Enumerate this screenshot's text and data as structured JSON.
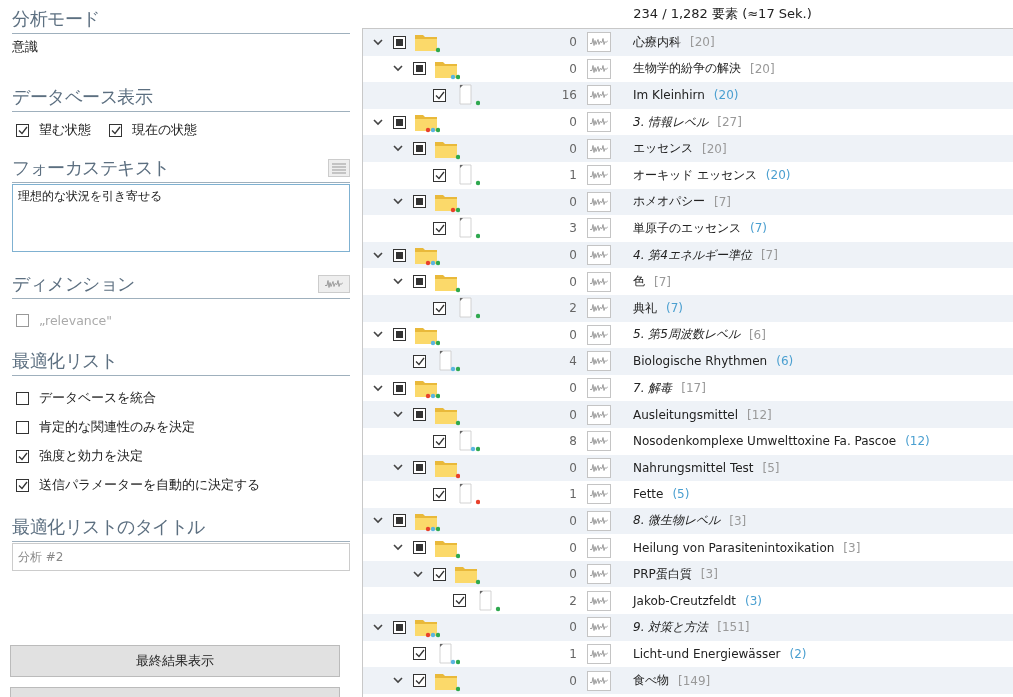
{
  "sidebar": {
    "sections": [
      {
        "kind": "mode",
        "title": "分析モード",
        "value": "意識"
      },
      {
        "kind": "check-row",
        "title": "データベース表示",
        "options": [
          {
            "label": "望む状態",
            "checked": true,
            "disabled": false
          },
          {
            "label": "現在の状態",
            "checked": true,
            "disabled": false
          }
        ]
      },
      {
        "kind": "textarea",
        "title": "フォーカステキスト",
        "value": "理想的な状況を引き寄せる"
      },
      {
        "kind": "check-list",
        "title": "ディメンション",
        "wave_button": true,
        "options": [
          {
            "label": "„relevance\"",
            "checked": false,
            "disabled": true
          }
        ]
      },
      {
        "kind": "check-list",
        "title": "最適化リスト",
        "options": [
          {
            "label": "データベースを統合",
            "checked": false,
            "disabled": false
          },
          {
            "label": "肯定的な関連性のみを決定",
            "checked": false,
            "disabled": false
          },
          {
            "label": "強度と効力を決定",
            "checked": true,
            "disabled": false
          },
          {
            "label": "送信パラメーターを自動的に決定する",
            "checked": true,
            "disabled": false
          }
        ]
      },
      {
        "kind": "input",
        "title": "最適化リストのタイトル",
        "placeholder": "分析 #2"
      }
    ],
    "buttons": [
      "最終結果表示"
    ],
    "more_buttons_below": true
  },
  "tree": {
    "summary": "234 / 1,282 要素 (≈17 Sek.)",
    "items": [
      {
        "children": [
          {
            "kind": "folder",
            "checked": false,
            "partial": true,
            "expanded": true,
            "count": "0",
            "label": "心療内科",
            "tally": "[20]",
            "emphasized": false,
            "markers": [
              {
                "color": "#2fa84f"
              }
            ],
            "children": [
              {
                "kind": "folder",
                "checked": false,
                "partial": true,
                "expanded": true,
                "count": "0",
                "label": "生物学的紛争の解決",
                "tally": "[20]",
                "emphasized": false,
                "markers": [
                  {
                    "color": "#5bb5e0"
                  },
                  {
                    "color": "#2fa84f"
                  }
                ],
                "children": [
                  {
                    "kind": "file",
                    "checked": true,
                    "partial": false,
                    "count": "16",
                    "label": "Im Kleinhirn",
                    "tally": "(20)",
                    "emphasized": false,
                    "markers": [
                      {
                        "color": "#2fa84f"
                      }
                    ]
                  }
                ]
              }
            ]
          }
        ]
      },
      {
        "kind": "folder",
        "checked": false,
        "partial": true,
        "expanded": true,
        "count": "0",
        "label": "3. 情報レベル",
        "tally": "[27]",
        "emphasized": true,
        "markers": [
          {
            "color": "#e8412c"
          },
          {
            "color": "#5bb5e0"
          },
          {
            "color": "#2fa84f"
          }
        ],
        "children": [
          {
            "kind": "folder",
            "checked": false,
            "partial": true,
            "expanded": true,
            "count": "0",
            "label": "エッセンス",
            "tally": "[20]",
            "emphasized": false,
            "markers": [
              {
                "color": "#2fa84f"
              }
            ],
            "children": [
              {
                "kind": "file",
                "checked": true,
                "partial": false,
                "count": "1",
                "label": "オーキッド エッセンス",
                "tally": "(20)",
                "emphasized": false,
                "markers": [
                  {
                    "color": "#2fa84f"
                  }
                ]
              }
            ]
          },
          {
            "kind": "folder",
            "checked": false,
            "partial": true,
            "expanded": true,
            "count": "0",
            "label": "ホメオパシー",
            "tally": "[7]",
            "emphasized": false,
            "markers": [
              {
                "color": "#e8412c"
              },
              {
                "color": "#2fa84f"
              }
            ],
            "children": [
              {
                "kind": "file",
                "checked": true,
                "partial": false,
                "count": "3",
                "label": "単原子のエッセンス",
                "tally": "(7)",
                "emphasized": false,
                "markers": [
                  {
                    "color": "#2fa84f"
                  }
                ]
              }
            ]
          }
        ]
      },
      {
        "kind": "folder",
        "checked": false,
        "partial": true,
        "expanded": true,
        "count": "0",
        "label": "4. 第4エネルギー準位",
        "tally": "[7]",
        "emphasized": true,
        "markers": [
          {
            "color": "#e8412c"
          },
          {
            "color": "#5bb5e0"
          },
          {
            "color": "#2fa84f"
          }
        ],
        "children": [
          {
            "kind": "folder",
            "checked": false,
            "partial": true,
            "expanded": true,
            "count": "0",
            "label": "色",
            "tally": "[7]",
            "emphasized": false,
            "markers": [
              {
                "color": "#2fa84f"
              }
            ],
            "children": [
              {
                "kind": "file",
                "checked": true,
                "partial": false,
                "count": "2",
                "label": "典礼",
                "tally": "(7)",
                "emphasized": false,
                "markers": [
                  {
                    "color": "#2fa84f"
                  }
                ]
              }
            ]
          }
        ]
      },
      {
        "kind": "folder",
        "checked": false,
        "partial": true,
        "expanded": true,
        "count": "0",
        "label": "5. 第5周波数レベル",
        "tally": "[6]",
        "emphasized": true,
        "markers": [
          {
            "color": "#5bb5e0"
          },
          {
            "color": "#2fa84f"
          }
        ],
        "children": [
          {
            "kind": "file",
            "checked": true,
            "partial": false,
            "count": "4",
            "label": "Biologische Rhythmen",
            "tally": "(6)",
            "emphasized": false,
            "markers": [
              {
                "color": "#5bb5e0"
              },
              {
                "color": "#2fa84f"
              }
            ]
          }
        ]
      },
      {
        "kind": "folder",
        "checked": false,
        "partial": true,
        "expanded": true,
        "count": "0",
        "label": "7. 解毒",
        "tally": "[17]",
        "emphasized": true,
        "markers": [
          {
            "color": "#e8412c"
          },
          {
            "color": "#5bb5e0"
          },
          {
            "color": "#2fa84f"
          }
        ],
        "children": [
          {
            "kind": "folder",
            "checked": false,
            "partial": true,
            "expanded": true,
            "count": "0",
            "label": "Ausleitungsmittel",
            "tally": "[12]",
            "emphasized": false,
            "markers": [
              {
                "color": "#2fa84f"
              }
            ],
            "children": [
              {
                "kind": "file",
                "checked": true,
                "partial": false,
                "count": "8",
                "label": "Nosodenkomplexe Umwelttoxine Fa. Pascoe",
                "tally": "(12)",
                "emphasized": false,
                "markers": [
                  {
                    "color": "#5bb5e0"
                  },
                  {
                    "color": "#2fa84f"
                  }
                ]
              }
            ]
          },
          {
            "kind": "folder",
            "checked": false,
            "partial": true,
            "expanded": true,
            "count": "0",
            "label": "Nahrungsmittel Test",
            "tally": "[5]",
            "emphasized": false,
            "markers": [
              {
                "color": "#e8412c"
              }
            ],
            "children": [
              {
                "kind": "file",
                "checked": true,
                "partial": false,
                "count": "1",
                "label": "Fette",
                "tally": "(5)",
                "emphasized": false,
                "markers": [
                  {
                    "color": "#e8412c"
                  }
                ]
              }
            ]
          }
        ]
      },
      {
        "kind": "folder",
        "checked": false,
        "partial": true,
        "expanded": true,
        "count": "0",
        "label": "8. 微生物レベル",
        "tally": "[3]",
        "emphasized": true,
        "markers": [
          {
            "color": "#e8412c"
          },
          {
            "color": "#5bb5e0"
          },
          {
            "color": "#2fa84f"
          }
        ],
        "children": [
          {
            "kind": "folder",
            "checked": false,
            "partial": true,
            "expanded": true,
            "count": "0",
            "label": "Heilung von Parasitenintoxikation",
            "tally": "[3]",
            "emphasized": false,
            "markers": [
              {
                "color": "#2fa84f"
              }
            ],
            "children": [
              {
                "kind": "folder",
                "checked": true,
                "partial": false,
                "expanded": true,
                "count": "0",
                "label": "PRP蛋白質",
                "tally": "[3]",
                "emphasized": false,
                "markers": [
                  {
                    "color": "#2fa84f"
                  }
                ],
                "children": [
                  {
                    "kind": "file",
                    "checked": true,
                    "partial": false,
                    "count": "2",
                    "label": "Jakob-Creutzfeldt",
                    "tally": "(3)",
                    "emphasized": false,
                    "markers": [
                      {
                        "color": "#2fa84f"
                      }
                    ]
                  }
                ]
              }
            ]
          }
        ]
      },
      {
        "kind": "folder",
        "checked": false,
        "partial": true,
        "expanded": true,
        "count": "0",
        "label": "9. 対策と方法",
        "tally": "[151]",
        "emphasized": true,
        "markers": [
          {
            "color": "#e8412c"
          },
          {
            "color": "#5bb5e0"
          },
          {
            "color": "#2fa84f"
          }
        ],
        "children": [
          {
            "kind": "file",
            "checked": true,
            "partial": false,
            "count": "1",
            "label": "Licht-und Energiewässer",
            "tally": "(2)",
            "emphasized": false,
            "markers": [
              {
                "color": "#5bb5e0"
              },
              {
                "color": "#2fa84f"
              }
            ]
          },
          {
            "kind": "folder",
            "checked": true,
            "partial": false,
            "expanded": true,
            "count": "0",
            "label": "食べ物",
            "tally": "[149]",
            "emphasized": false,
            "markers": [
              {
                "color": "#2fa84f"
              }
            ]
          }
        ]
      }
    ]
  }
}
